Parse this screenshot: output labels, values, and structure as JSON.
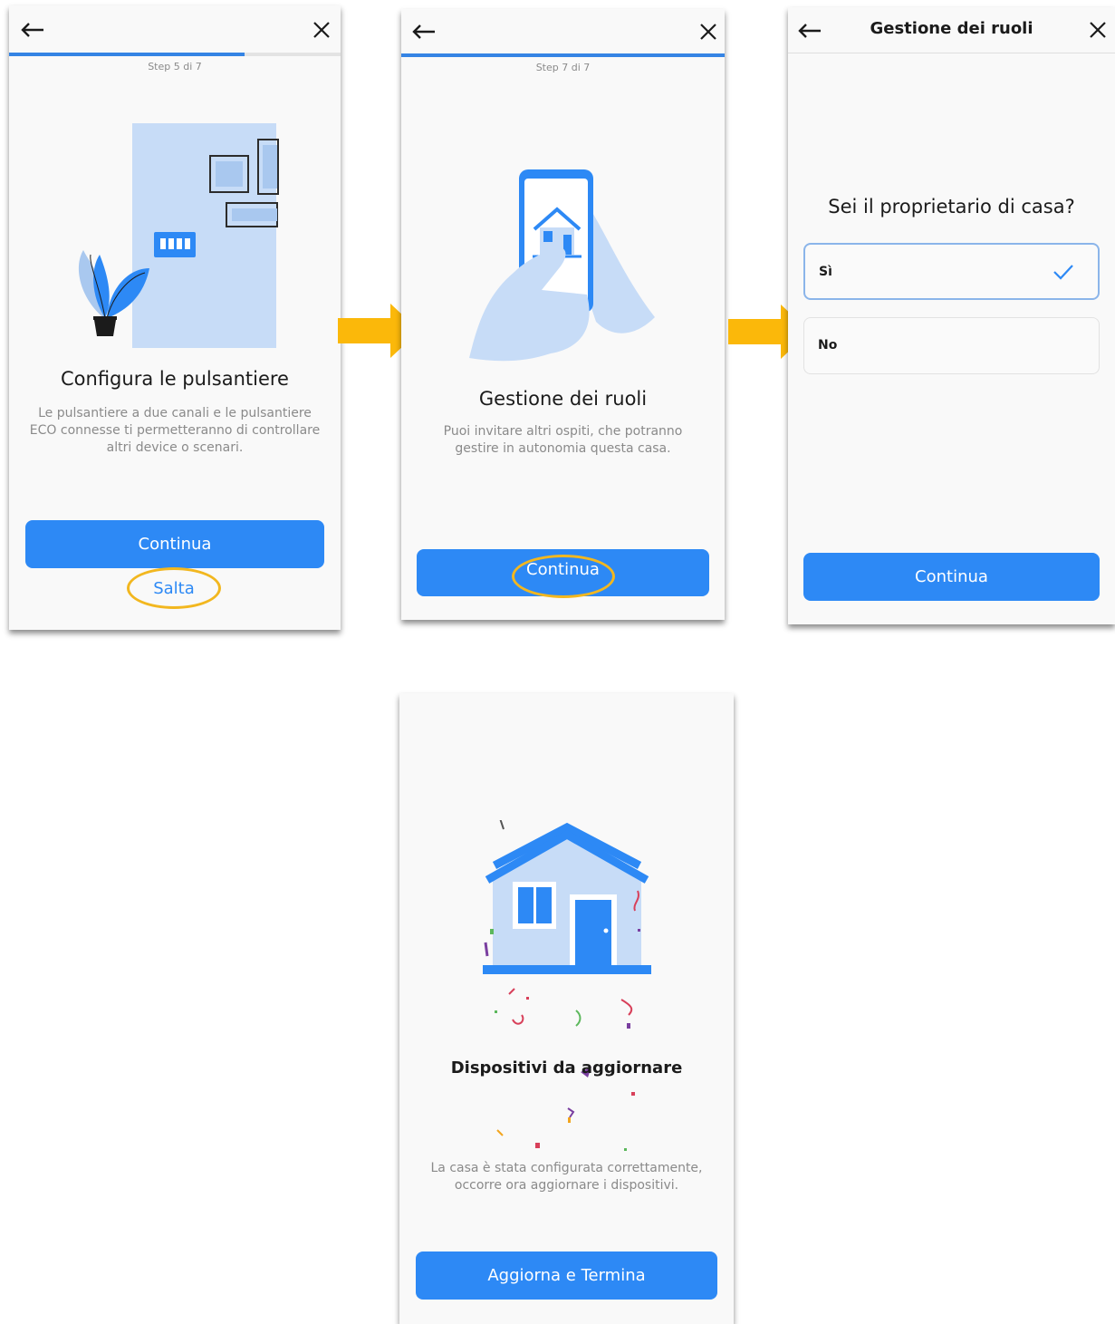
{
  "screen1": {
    "step": "Step 5 di 7",
    "progress": 0.71,
    "title": "Configura le pulsantiere",
    "description": "Le pulsantiere a due canali e le pulsantiere ECO connesse ti permetteranno di controllare altri device o scenari.",
    "continue_label": "Continua",
    "skip_label": "Salta"
  },
  "screen2": {
    "step": "Step 7 di 7",
    "progress": 1.0,
    "title": "Gestione dei ruoli",
    "description": "Puoi invitare altri ospiti, che potranno gestire in autonomia questa casa.",
    "continue_label": "Continua"
  },
  "screen3": {
    "header_title": "Gestione dei ruoli",
    "question": "Sei il proprietario di casa?",
    "options": [
      {
        "label": "Sì",
        "selected": true
      },
      {
        "label": "No",
        "selected": false
      }
    ],
    "continue_label": "Continua"
  },
  "screen4": {
    "title": "Dispositivi da aggiornare",
    "description": "La casa è stata configurata correttamente, occorre ora aggiornare i dispositivi.",
    "button_label": "Aggiorna e Termina"
  },
  "icons": [
    "back-arrow-icon",
    "close-icon",
    "checkmark-icon",
    "flow-arrow-icon"
  ],
  "colors": {
    "accent": "#2d89f5",
    "highlight": "#f2b71f",
    "illustration": "#c7dcf7",
    "flow_arrow": "#fbb80a"
  }
}
